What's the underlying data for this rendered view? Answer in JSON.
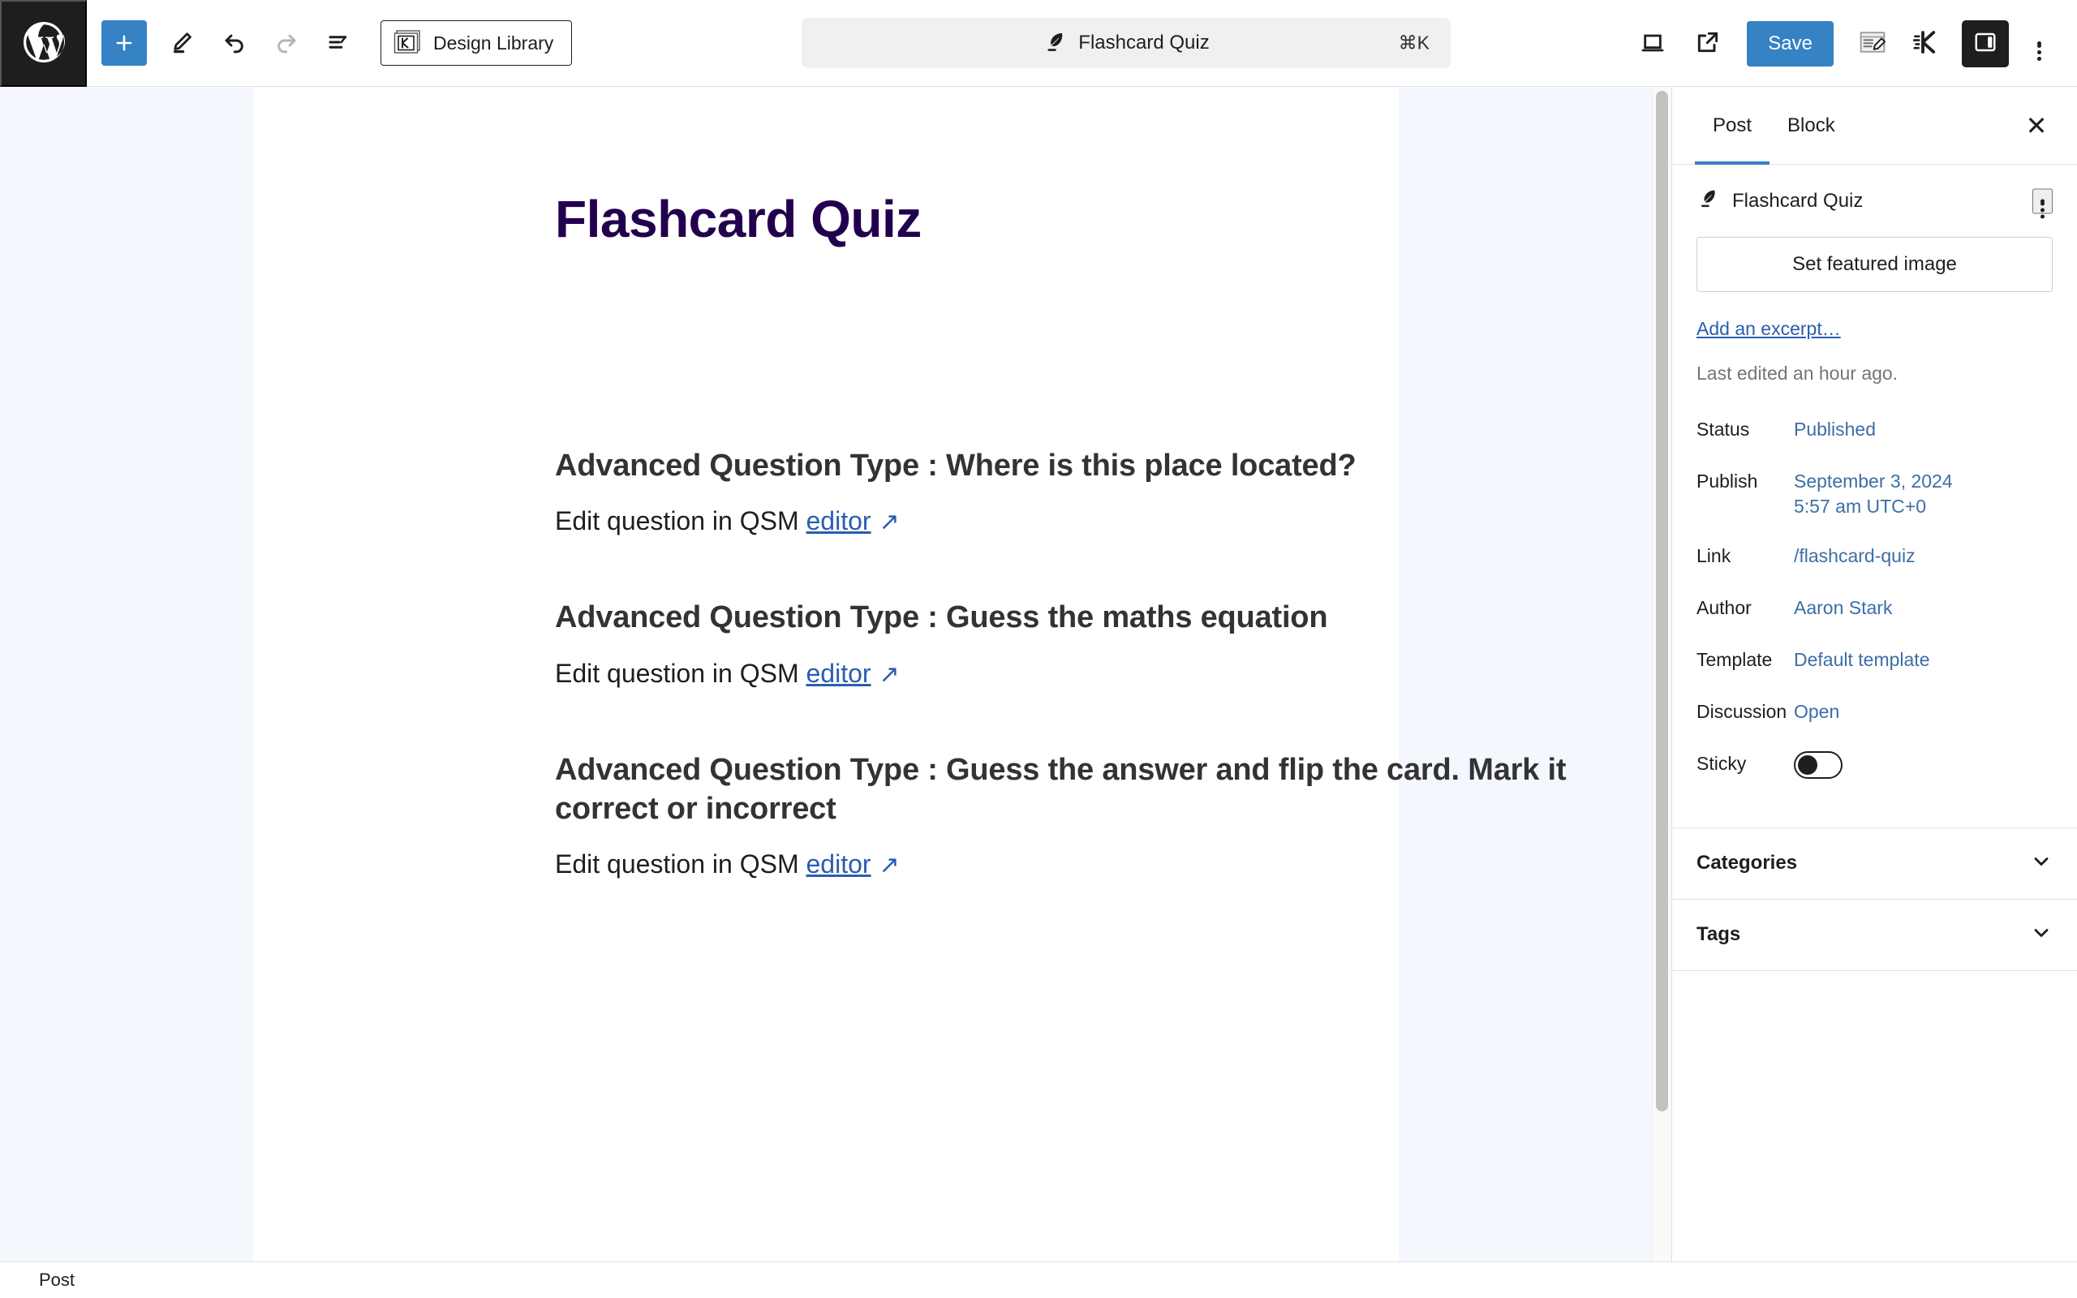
{
  "header": {
    "wp_logo": "wordpress-logo",
    "tools": [
      {
        "name": "add-block-button",
        "label": "+"
      },
      {
        "name": "edit-mode-button",
        "label": "Edit"
      },
      {
        "name": "undo-button",
        "label": "Undo"
      },
      {
        "name": "redo-button",
        "label": "Redo"
      },
      {
        "name": "list-view-button",
        "label": "Document Overview"
      }
    ],
    "design_library_label": "Design Library",
    "command_bar": {
      "title": "Flashcard Quiz",
      "shortcut": "⌘K"
    },
    "right_tools": [
      {
        "name": "view-button",
        "label": "View"
      },
      {
        "name": "preview-external-button",
        "label": "Preview"
      }
    ],
    "save_label": "Save",
    "options_label": "Options"
  },
  "editor": {
    "post_title": "Flashcard Quiz",
    "blocks": [
      {
        "heading": "Advanced Question Type : Where is this place located?",
        "prefix": "Edit question in QSM ",
        "link_label": "editor",
        "arrow": "↗"
      },
      {
        "heading": "Advanced Question Type : Guess the maths equation",
        "prefix": "Edit question in QSM ",
        "link_label": "editor",
        "arrow": "↗"
      },
      {
        "heading": "Advanced Question Type : Guess the answer and flip the card. Mark it correct or incorrect",
        "prefix": "Edit question in QSM ",
        "link_label": "editor",
        "arrow": "↗"
      }
    ]
  },
  "sidebar": {
    "tabs": [
      {
        "label": "Post",
        "active": true
      },
      {
        "label": "Block",
        "active": false
      }
    ],
    "close_label": "✕",
    "document_title": "Flashcard Quiz",
    "featured_image_label": "Set featured image",
    "excerpt_label": "Add an excerpt…",
    "last_edited": "Last edited an hour ago.",
    "meta": [
      {
        "label": "Status",
        "value": "Published",
        "type": "link"
      },
      {
        "label": "Publish",
        "value": "September 3, 2024 5:57 am UTC+0",
        "type": "link"
      },
      {
        "label": "Link",
        "value": "/flashcard-quiz",
        "type": "link"
      },
      {
        "label": "Author",
        "value": "Aaron Stark",
        "type": "link"
      },
      {
        "label": "Template",
        "value": "Default template",
        "type": "link"
      },
      {
        "label": "Discussion",
        "value": "Open",
        "type": "link"
      },
      {
        "label": "Sticky",
        "value": "",
        "type": "toggle",
        "toggle_on": false
      }
    ],
    "panels": [
      {
        "label": "Categories"
      },
      {
        "label": "Tags"
      }
    ]
  },
  "footer": {
    "breadcrumb": "Post"
  },
  "colors": {
    "accent_blue": "#3582c4",
    "link_blue": "#2a5db0",
    "sidebar_link": "#3c6ea5",
    "title_purple": "#23004d",
    "canvas_bg": "#f4f7fd",
    "dark": "#1e1e1e"
  }
}
